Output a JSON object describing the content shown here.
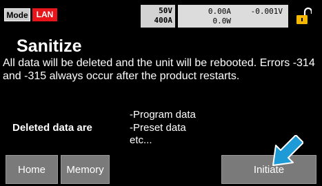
{
  "status_bar": {
    "mode_label": "Mode",
    "lan_label": "LAN",
    "rating_voltage": "50V",
    "rating_current": "400A",
    "measured_current": "0.00A",
    "measured_voltage": "-0.001V",
    "measured_power": "0.0W",
    "lock_icon": "padlock-unlocked"
  },
  "main": {
    "title": "Sanitize",
    "description": "All data will be deleted and the unit will be rebooted. Errors -314 and -315 always occur after the product restarts.",
    "deleted_label": "Deleted data are",
    "deleted_items": [
      "-Program data",
      "-Preset data",
      "etc..."
    ]
  },
  "buttons": {
    "home": "Home",
    "memory": "Memory",
    "initiate": "Initiate"
  },
  "colors": {
    "lan_badge": "#e8161b",
    "lock_accent": "#f5b800",
    "pointer_arrow": "#1e9ad6",
    "button_bg": "#7a7a7a"
  }
}
